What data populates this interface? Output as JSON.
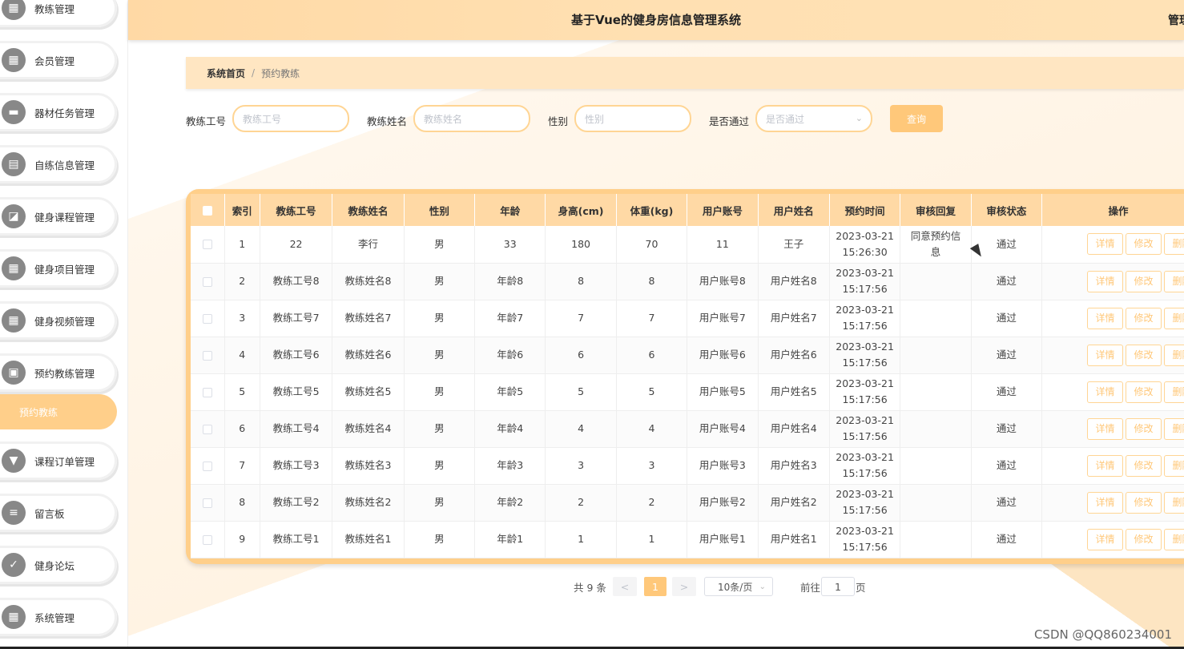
{
  "header": {
    "title": "基于Vue的健身房信息管理系统",
    "right_text": "管理"
  },
  "sidebar": {
    "items": [
      {
        "label": "教练管理",
        "icon": "grid-icon"
      },
      {
        "label": "会员管理",
        "icon": "grid-icon"
      },
      {
        "label": "器材任务管理",
        "icon": "monitor-icon"
      },
      {
        "label": "自练信息管理",
        "icon": "clipboard-icon"
      },
      {
        "label": "健身课程管理",
        "icon": "chart-icon"
      },
      {
        "label": "健身项目管理",
        "icon": "grid-icon"
      },
      {
        "label": "健身视频管理",
        "icon": "grid-icon"
      },
      {
        "label": "预约教练管理",
        "icon": "briefcase-icon"
      },
      {
        "label": "课程订单管理",
        "icon": "presentation-icon"
      },
      {
        "label": "留言板",
        "icon": "sliders-icon"
      },
      {
        "label": "健身论坛",
        "icon": "checklist-icon"
      },
      {
        "label": "系统管理",
        "icon": "grid-icon"
      }
    ],
    "active_sub": "预约教练"
  },
  "breadcrumb": {
    "home": "系统首页",
    "separator": "/",
    "current": "预约教练"
  },
  "search": {
    "coach_no_label": "教练工号",
    "coach_no_placeholder": "教练工号",
    "coach_name_label": "教练姓名",
    "coach_name_placeholder": "教练姓名",
    "gender_label": "性别",
    "gender_placeholder": "性别",
    "approved_label": "是否通过",
    "approved_placeholder": "是否通过",
    "query_button": "查询"
  },
  "table": {
    "headers": [
      "索引",
      "教练工号",
      "教练姓名",
      "性别",
      "年龄",
      "身高(cm)",
      "体重(kg)",
      "用户账号",
      "用户姓名",
      "预约时间",
      "审核回复",
      "审核状态",
      "操作"
    ],
    "rows": [
      {
        "index": "1",
        "coach_no": "22",
        "coach_name": "李行",
        "gender": "男",
        "age": "33",
        "height": "180",
        "weight": "70",
        "user_account": "11",
        "user_name": "王子",
        "date": "2023-03-21",
        "time": "15:26:30",
        "reply": "同意预约信息",
        "status": "通过"
      },
      {
        "index": "2",
        "coach_no": "教练工号8",
        "coach_name": "教练姓名8",
        "gender": "男",
        "age": "年龄8",
        "height": "8",
        "weight": "8",
        "user_account": "用户账号8",
        "user_name": "用户姓名8",
        "date": "2023-03-21",
        "time": "15:17:56",
        "reply": "",
        "status": "通过"
      },
      {
        "index": "3",
        "coach_no": "教练工号7",
        "coach_name": "教练姓名7",
        "gender": "男",
        "age": "年龄7",
        "height": "7",
        "weight": "7",
        "user_account": "用户账号7",
        "user_name": "用户姓名7",
        "date": "2023-03-21",
        "time": "15:17:56",
        "reply": "",
        "status": "通过"
      },
      {
        "index": "4",
        "coach_no": "教练工号6",
        "coach_name": "教练姓名6",
        "gender": "男",
        "age": "年龄6",
        "height": "6",
        "weight": "6",
        "user_account": "用户账号6",
        "user_name": "用户姓名6",
        "date": "2023-03-21",
        "time": "15:17:56",
        "reply": "",
        "status": "通过"
      },
      {
        "index": "5",
        "coach_no": "教练工号5",
        "coach_name": "教练姓名5",
        "gender": "男",
        "age": "年龄5",
        "height": "5",
        "weight": "5",
        "user_account": "用户账号5",
        "user_name": "用户姓名5",
        "date": "2023-03-21",
        "time": "15:17:56",
        "reply": "",
        "status": "通过"
      },
      {
        "index": "6",
        "coach_no": "教练工号4",
        "coach_name": "教练姓名4",
        "gender": "男",
        "age": "年龄4",
        "height": "4",
        "weight": "4",
        "user_account": "用户账号4",
        "user_name": "用户姓名4",
        "date": "2023-03-21",
        "time": "15:17:56",
        "reply": "",
        "status": "通过"
      },
      {
        "index": "7",
        "coach_no": "教练工号3",
        "coach_name": "教练姓名3",
        "gender": "男",
        "age": "年龄3",
        "height": "3",
        "weight": "3",
        "user_account": "用户账号3",
        "user_name": "用户姓名3",
        "date": "2023-03-21",
        "time": "15:17:56",
        "reply": "",
        "status": "通过"
      },
      {
        "index": "8",
        "coach_no": "教练工号2",
        "coach_name": "教练姓名2",
        "gender": "男",
        "age": "年龄2",
        "height": "2",
        "weight": "2",
        "user_account": "用户账号2",
        "user_name": "用户姓名2",
        "date": "2023-03-21",
        "time": "15:17:56",
        "reply": "",
        "status": "通过"
      },
      {
        "index": "9",
        "coach_no": "教练工号1",
        "coach_name": "教练姓名1",
        "gender": "男",
        "age": "年龄1",
        "height": "1",
        "weight": "1",
        "user_account": "用户账号1",
        "user_name": "用户姓名1",
        "date": "2023-03-21",
        "time": "15:17:56",
        "reply": "",
        "status": "通过"
      }
    ],
    "actions": {
      "detail": "详情",
      "edit": "修改",
      "delete": "删除"
    }
  },
  "pagination": {
    "total_text": "共 9 条",
    "prev": "<",
    "current_page": "1",
    "next": ">",
    "page_size": "10条/页",
    "goto_label": "前往",
    "goto_value": "1",
    "page_unit": "页"
  },
  "watermark": "CSDN @QQ860234001",
  "colors": {
    "accent": "#ffc87a",
    "header_bg": "#ffd9a5",
    "border": "#ffd594"
  }
}
